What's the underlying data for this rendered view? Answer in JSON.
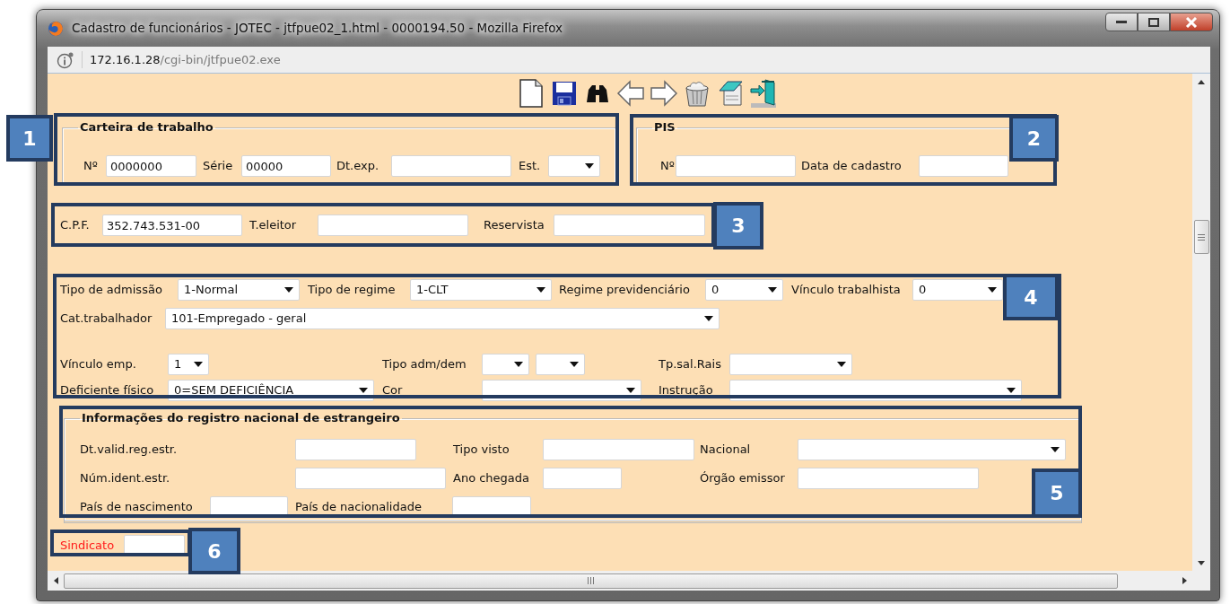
{
  "window": {
    "title": "Cadastro de funcionários - JOTEC - jtfpue02_1.html - 0000194.50 - Mozilla Firefox",
    "address_host": "172.16.1.28",
    "address_path": "/cgi-bin/jtfpue02.exe"
  },
  "carteira_de_trabalho": {
    "legend": "Carteira de trabalho",
    "rows": [
      [
        {
          "label": "Nº",
          "kind": "text",
          "value": "0000000"
        },
        {
          "label": "Série",
          "kind": "text",
          "value": "00000"
        },
        {
          "label": "Dt.exp.",
          "kind": "text"
        },
        {
          "label": "Est.",
          "kind": "select"
        }
      ]
    ]
  },
  "pis": {
    "legend": "PIS",
    "rows": [
      [
        {
          "label": "Nº",
          "kind": "text"
        },
        {
          "label": "Data de cadastro",
          "kind": "text"
        }
      ]
    ]
  },
  "documentos": {
    "rows": [
      [
        {
          "label": "C.P.F.",
          "kind": "text",
          "value": "352.743.531-00"
        },
        {
          "label": "T.eleitor",
          "kind": "text"
        },
        {
          "label": "Reservista",
          "kind": "text"
        }
      ]
    ]
  },
  "vinculo": {
    "rows": [
      [
        {
          "label": "Tipo de admissão",
          "kind": "select",
          "value": "1-Normal"
        },
        {
          "label": "Tipo de regime",
          "kind": "select",
          "value": "1-CLT"
        },
        {
          "label": "Regime previdenciário",
          "kind": "select",
          "value": "0"
        },
        {
          "label": "Vínculo trabalhista",
          "kind": "select",
          "value": "0"
        }
      ],
      [
        {
          "label": "Cat.trabalhador",
          "kind": "select",
          "value": "101-Empregado - geral"
        }
      ],
      [
        {
          "label": "Vínculo emp.",
          "kind": "select",
          "value": "1"
        },
        {
          "label": "Tipo adm/dem",
          "kind": "select_pair"
        },
        {
          "label": "Tp.sal.Rais",
          "kind": "select"
        }
      ],
      [
        {
          "label": "Deficiente físico",
          "kind": "select",
          "value": "0=SEM DEFICIÊNCIA"
        },
        {
          "label": "Cor",
          "kind": "select"
        },
        {
          "label": "Instrução",
          "kind": "select"
        }
      ]
    ]
  },
  "estrangeiro": {
    "legend": "Informações do registro nacional de estrangeiro",
    "rows": [
      [
        {
          "label": "Dt.valid.reg.estr.",
          "kind": "text"
        },
        {
          "label": "Tipo visto",
          "kind": "text"
        },
        {
          "label": "Nacional",
          "kind": "select"
        }
      ],
      [
        {
          "label": "Núm.ident.estr.",
          "kind": "text"
        },
        {
          "label": "Ano chegada",
          "kind": "text"
        },
        {
          "label": "Órgão emissor",
          "kind": "text"
        }
      ],
      [
        {
          "label": "País de nascimento",
          "kind": "text"
        },
        {
          "label": "País de nacionalidade",
          "kind": "text"
        }
      ]
    ]
  },
  "sindicato": {
    "rows": [
      [
        {
          "label": "Sindicato",
          "kind": "text",
          "required": true
        }
      ]
    ]
  },
  "callouts": [
    {
      "number": "1"
    },
    {
      "number": "2"
    },
    {
      "number": "3"
    },
    {
      "number": "4"
    },
    {
      "number": "5"
    },
    {
      "number": "6"
    }
  ]
}
